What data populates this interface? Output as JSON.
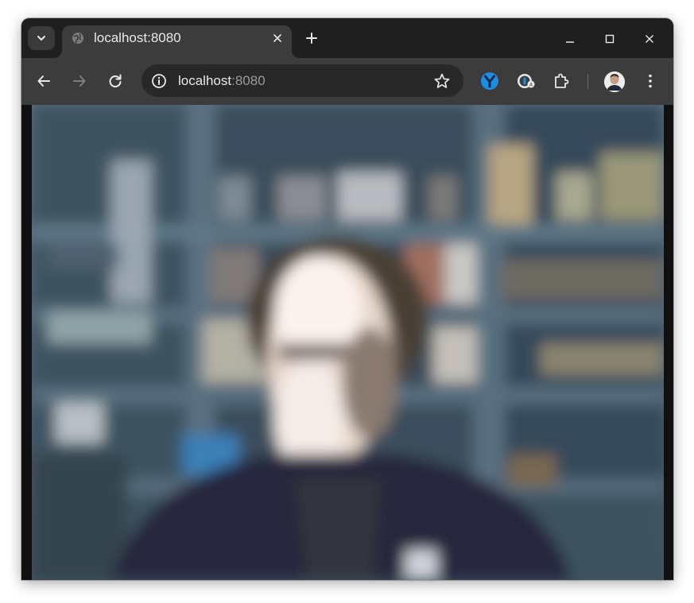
{
  "tab": {
    "title": "localhost:8080",
    "favicon": "globe-icon"
  },
  "omnibox": {
    "host": "localhost",
    "port": ":8080"
  },
  "icons": {
    "tab_search": "chevron-down-icon",
    "tab_close": "close-icon",
    "new_tab": "plus-icon",
    "minimize": "minimize-icon",
    "maximize": "maximize-icon",
    "close_window": "close-icon",
    "back": "arrow-left-icon",
    "forward": "arrow-right-icon",
    "reload": "reload-icon",
    "site_info": "info-icon",
    "bookmark": "star-icon",
    "extension_1": "y-badge-icon",
    "extension_2": "password-manager-icon",
    "extensions": "puzzle-icon",
    "profile": "avatar",
    "menu": "more-vertical-icon"
  },
  "colors": {
    "frame": "#1f1f1f",
    "toolbar": "#3c3c3c",
    "omnibox": "#282828",
    "extension_blue": "#1a8fe3"
  },
  "content": {
    "type": "webcam video (heavily blurred)"
  }
}
